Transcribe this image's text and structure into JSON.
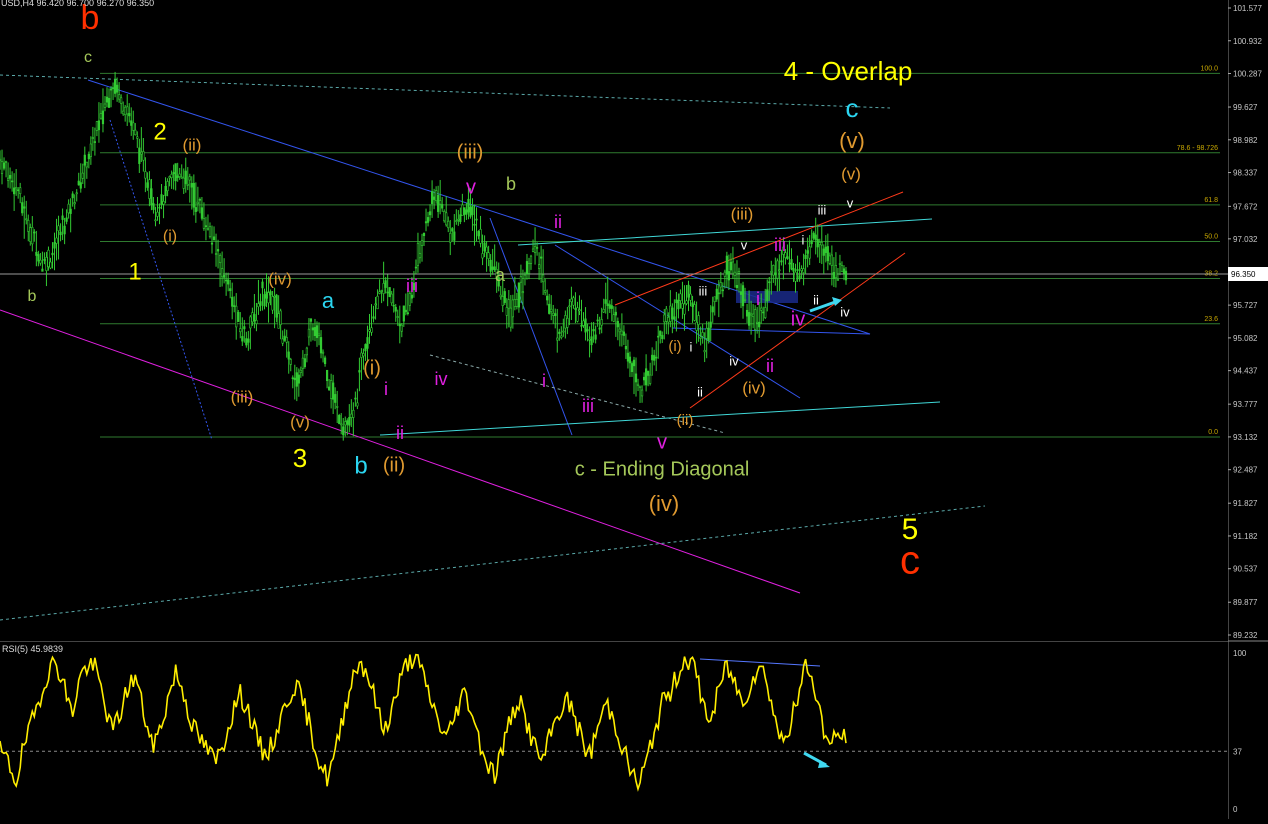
{
  "header": {
    "symbol_info": "USD,H4  96.420 96.700 96.270 96.350"
  },
  "rsi_label": "RSI(5) 45.9839",
  "chart_data": [
    {
      "type": "candlestick",
      "title": "",
      "y_ticks": [
        "101.577",
        "100.932",
        "100.287",
        "99.627",
        "98.982",
        "98.337",
        "97.672",
        "97.032",
        "96.350",
        "95.727",
        "95.082",
        "94.437",
        "93.777",
        "93.132",
        "92.487",
        "91.827",
        "91.182",
        "90.537",
        "89.877",
        "89.232"
      ],
      "ylim": [
        89.232,
        101.577
      ],
      "current_price": "96.350",
      "fib_levels": [
        {
          "label": "100.0",
          "value": 100.29
        },
        {
          "label": "78.6 - 98.726",
          "value": 98.726
        },
        {
          "label": "61.8",
          "value": 97.7
        },
        {
          "label": "50.0",
          "value": 96.98
        },
        {
          "label": "38.2",
          "value": 96.25
        },
        {
          "label": "23.6",
          "value": 95.36
        },
        {
          "label": "0.0",
          "value": 93.13
        }
      ],
      "price_path": [
        98.6,
        98.3,
        98.1,
        97.5,
        97.1,
        96.6,
        96.6,
        97.0,
        97.4,
        97.8,
        98.3,
        98.7,
        99.3,
        99.8,
        100.1,
        99.7,
        99.4,
        98.8,
        98.2,
        97.6,
        97.8,
        98.2,
        98.4,
        98.1,
        97.8,
        97.4,
        97.0,
        96.5,
        96.0,
        95.4,
        95.1,
        95.5,
        96.0,
        95.9,
        95.5,
        94.8,
        94.1,
        94.6,
        95.3,
        95.0,
        94.3,
        93.7,
        93.3,
        93.5,
        94.5,
        95.4,
        95.9,
        96.1,
        95.7,
        95.3,
        95.9,
        96.7,
        97.4,
        97.9,
        97.6,
        97.1,
        97.5,
        97.7,
        97.3,
        96.8,
        96.6,
        96.0,
        95.5,
        95.9,
        96.3,
        96.9,
        96.4,
        95.7,
        95.2,
        95.4,
        95.8,
        95.5,
        95.1,
        95.4,
        95.8,
        95.4,
        95.0,
        94.5,
        94.0,
        94.4,
        94.9,
        95.4,
        95.6,
        95.8,
        95.9,
        95.3,
        95.0,
        95.7,
        96.2,
        96.6,
        96.1,
        95.7,
        95.3,
        95.7,
        96.3,
        96.6,
        96.7,
        96.3,
        96.6,
        97.2,
        96.9,
        96.6,
        96.4,
        96.3
      ],
      "wave_labels": [
        {
          "text": "b",
          "color": "#ff3000",
          "x": 90,
          "y": 20,
          "size": 34
        },
        {
          "text": "c",
          "color": "#a5c85a",
          "x": 88,
          "y": 58,
          "size": 16
        },
        {
          "text": "b",
          "color": "#a5c85a",
          "x": 32,
          "y": 297,
          "size": 16
        },
        {
          "text": "2",
          "color": "#ffff00",
          "x": 160,
          "y": 133,
          "size": 24
        },
        {
          "text": "(ii)",
          "color": "#e09a30",
          "x": 192,
          "y": 146,
          "size": 17
        },
        {
          "text": "(i)",
          "color": "#e09a30",
          "x": 170,
          "y": 237,
          "size": 16
        },
        {
          "text": "1",
          "color": "#ffff00",
          "x": 135,
          "y": 273,
          "size": 24
        },
        {
          "text": "(iv)",
          "color": "#e09a30",
          "x": 280,
          "y": 280,
          "size": 17
        },
        {
          "text": "a",
          "color": "#2bd5f0",
          "x": 328,
          "y": 302,
          "size": 22
        },
        {
          "text": "iii",
          "color": "#e020e0",
          "x": 412,
          "y": 287,
          "size": 18
        },
        {
          "text": "iv",
          "color": "#e020e0",
          "x": 441,
          "y": 380,
          "size": 18
        },
        {
          "text": "(iii)",
          "color": "#e09a30",
          "x": 242,
          "y": 398,
          "size": 17
        },
        {
          "text": "(v)",
          "color": "#e09a30",
          "x": 300,
          "y": 423,
          "size": 17
        },
        {
          "text": "3",
          "color": "#ffff00",
          "x": 300,
          "y": 460,
          "size": 26
        },
        {
          "text": "(i)",
          "color": "#e09a30",
          "x": 372,
          "y": 369,
          "size": 20
        },
        {
          "text": "i",
          "color": "#e020e0",
          "x": 386,
          "y": 390,
          "size": 18
        },
        {
          "text": "ii",
          "color": "#e020e0",
          "x": 400,
          "y": 434,
          "size": 18
        },
        {
          "text": "b",
          "color": "#2bd5f0",
          "x": 361,
          "y": 467,
          "size": 24
        },
        {
          "text": "(ii)",
          "color": "#e09a30",
          "x": 394,
          "y": 466,
          "size": 20
        },
        {
          "text": "(iii)",
          "color": "#e09a30",
          "x": 470,
          "y": 153,
          "size": 20
        },
        {
          "text": "v",
          "color": "#e020e0",
          "x": 471,
          "y": 188,
          "size": 20
        },
        {
          "text": "b",
          "color": "#a5c85a",
          "x": 511,
          "y": 185,
          "size": 18
        },
        {
          "text": "ii",
          "color": "#e020e0",
          "x": 558,
          "y": 223,
          "size": 18
        },
        {
          "text": "a",
          "color": "#a5c85a",
          "x": 500,
          "y": 276,
          "size": 18
        },
        {
          "text": "i",
          "color": "#e020e0",
          "x": 544,
          "y": 382,
          "size": 18
        },
        {
          "text": "iii",
          "color": "#e020e0",
          "x": 588,
          "y": 407,
          "size": 18
        },
        {
          "text": "v",
          "color": "#e020e0",
          "x": 662,
          "y": 443,
          "size": 20
        },
        {
          "text": "(ii)",
          "color": "#e09a30",
          "x": 685,
          "y": 421,
          "size": 15
        },
        {
          "text": "(i)",
          "color": "#e09a30",
          "x": 675,
          "y": 347,
          "size": 15
        },
        {
          "text": "i",
          "color": "#ffffff",
          "x": 691,
          "y": 348,
          "size": 13
        },
        {
          "text": "ii",
          "color": "#ffffff",
          "x": 700,
          "y": 393,
          "size": 13
        },
        {
          "text": "iii",
          "color": "#ffffff",
          "x": 703,
          "y": 292,
          "size": 13
        },
        {
          "text": "(iii)",
          "color": "#e09a30",
          "x": 742,
          "y": 215,
          "size": 17
        },
        {
          "text": "v",
          "color": "#ffffff",
          "x": 744,
          "y": 246,
          "size": 13
        },
        {
          "text": "iv",
          "color": "#ffffff",
          "x": 734,
          "y": 362,
          "size": 13
        },
        {
          "text": "(iv)",
          "color": "#e09a30",
          "x": 754,
          "y": 389,
          "size": 17
        },
        {
          "text": "i",
          "color": "#e020e0",
          "x": 758,
          "y": 300,
          "size": 18
        },
        {
          "text": "ii",
          "color": "#e020e0",
          "x": 770,
          "y": 367,
          "size": 18
        },
        {
          "text": "iii",
          "color": "#e020e0",
          "x": 780,
          "y": 246,
          "size": 18
        },
        {
          "text": "iv",
          "color": "#e020e0",
          "x": 798,
          "y": 320,
          "size": 20
        },
        {
          "text": "i",
          "color": "#ffffff",
          "x": 803,
          "y": 241,
          "size": 13
        },
        {
          "text": "ii",
          "color": "#ffffff",
          "x": 816,
          "y": 301,
          "size": 13
        },
        {
          "text": "iii",
          "color": "#ffffff",
          "x": 822,
          "y": 211,
          "size": 13
        },
        {
          "text": "v",
          "color": "#ffffff",
          "x": 850,
          "y": 204,
          "size": 13
        },
        {
          "text": "iv",
          "color": "#ffffff",
          "x": 845,
          "y": 313,
          "size": 13
        },
        {
          "text": "(v)",
          "color": "#e09a30",
          "x": 851,
          "y": 175,
          "size": 17
        },
        {
          "text": "(v)",
          "color": "#e09a30",
          "x": 852,
          "y": 142,
          "size": 22
        },
        {
          "text": "c",
          "color": "#2bd5f0",
          "x": 852,
          "y": 110,
          "size": 26
        },
        {
          "text": "4 - Overlap",
          "color": "#ffff00",
          "x": 848,
          "y": 73,
          "size": 26
        },
        {
          "text": "c - Ending Diagonal",
          "color": "#a5c85a",
          "x": 662,
          "y": 470,
          "size": 20
        },
        {
          "text": "(iv)",
          "color": "#e09a30",
          "x": 664,
          "y": 505,
          "size": 22
        },
        {
          "text": "5",
          "color": "#ffff00",
          "x": 910,
          "y": 531,
          "size": 30
        },
        {
          "text": "c",
          "color": "#ff3000",
          "x": 910,
          "y": 563,
          "size": 40
        }
      ]
    },
    {
      "type": "line",
      "title": "RSI(5) 45.9839",
      "series": [
        {
          "name": "RSI(5)",
          "values": [
            37,
            30,
            18,
            40,
            55,
            72,
            88,
            95,
            80,
            60,
            85,
            92,
            90,
            70,
            50,
            60,
            78,
            85,
            62,
            40,
            50,
            70,
            88,
            75,
            55,
            45,
            38,
            30,
            42,
            60,
            74,
            65,
            48,
            35,
            40,
            55,
            70,
            80,
            68,
            50,
            30,
            20,
            35,
            60,
            82,
            95,
            88,
            70,
            50,
            62,
            80,
            94,
            98,
            85,
            70,
            55,
            45,
            60,
            75,
            66,
            45,
            30,
            22,
            40,
            58,
            70,
            55,
            40,
            30,
            48,
            62,
            70,
            60,
            42,
            35,
            55,
            68,
            56,
            40,
            25,
            15,
            30,
            50,
            68,
            75,
            88,
            98,
            90,
            70,
            55,
            75,
            92,
            82,
            68,
            80,
            92,
            85,
            60,
            42,
            55,
            70,
            94,
            80,
            55,
            40,
            48,
            45.98
          ]
        }
      ],
      "ylim": [
        0,
        100
      ],
      "y_ticks": [
        "100",
        "37",
        "0"
      ],
      "reference_level": 37
    }
  ]
}
